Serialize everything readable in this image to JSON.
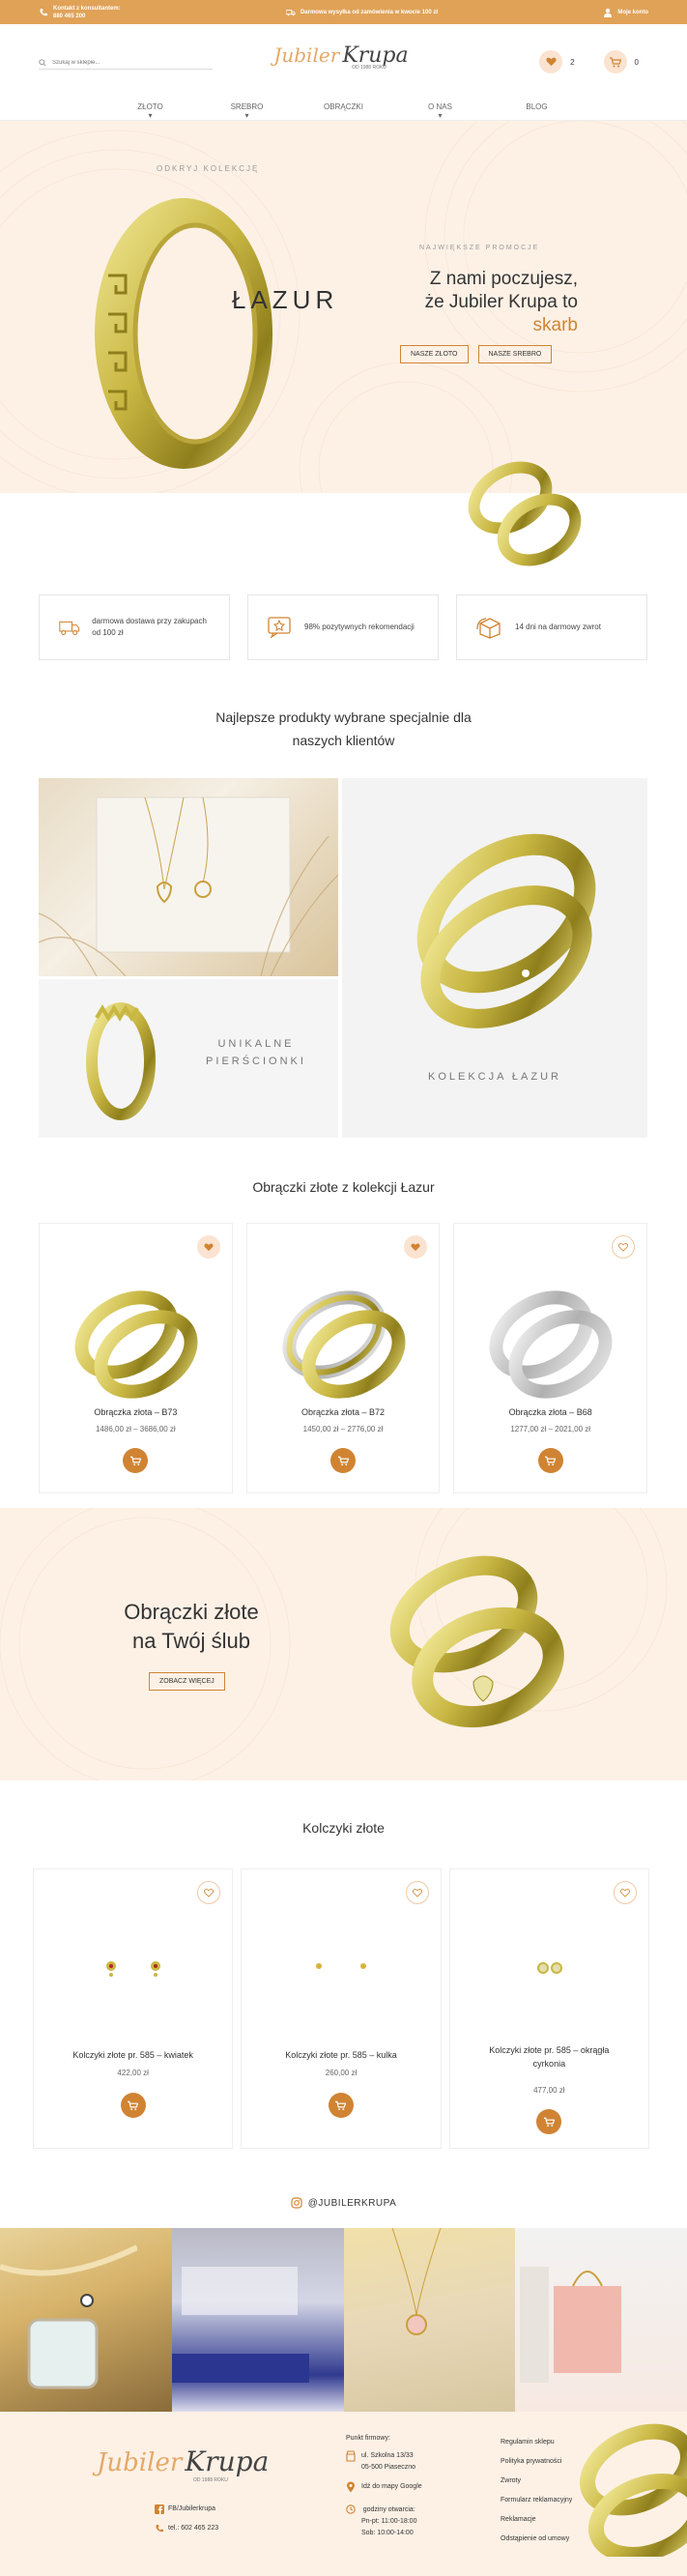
{
  "topbar": {
    "contact_label": "Kontakt z konsultantem:",
    "contact_phone": "880 465 200",
    "shipping_text": "Darmowa wysyłka od zamówienia w kwocie 100 zł",
    "account_label": "Moje konto"
  },
  "header": {
    "search_placeholder": "Szukaj w sklepie...",
    "logo_part1": "Jubiler",
    "logo_part2": "Krupa",
    "logo_since": "OD 1988 ROKU",
    "fav_count": "2",
    "cart_count": "0"
  },
  "nav": {
    "items": [
      {
        "label": "ZŁOTO"
      },
      {
        "label": "SREBRO"
      },
      {
        "label": "OBRĄCZKI"
      },
      {
        "label": "O NAS"
      },
      {
        "label": "BLOG"
      }
    ]
  },
  "hero": {
    "collection_label": "ODKRYJ KOLEKCJĘ",
    "collection_name": "ŁAZUR",
    "promo_label": "NAJWIĘKSZE PROMOCJE",
    "headline_line1": "Z nami poczujesz,",
    "headline_line2": "że Jubiler Krupa to",
    "headline_accent": "skarb",
    "btn_gold": "NASZE ZŁOTO",
    "btn_silver": "NASZE SREBRO"
  },
  "features": [
    {
      "icon": "truck-icon",
      "text": "darmowa dostawa przy zakupach od 100 zł"
    },
    {
      "icon": "rating-icon",
      "text": "98% pozytywnych rekomendacji"
    },
    {
      "icon": "box-return-icon",
      "text": "14 dni na darmowy zwrot"
    }
  ],
  "tagline": {
    "line1": "Najlepsze produkty wybrane specjalnie dla",
    "line2": "naszych klientów"
  },
  "banners": {
    "rings_label_1": "UNIKALNE",
    "rings_label_2": "PIERŚCIONKI",
    "collection_label": "KOLEKCJA ŁAZUR"
  },
  "section_rings": {
    "title": "Obrączki złote z kolekcji Łazur",
    "products": [
      {
        "name": "Obrączka złota – B73",
        "price": "1486,00 zł – 3686,00 zł",
        "fav": true
      },
      {
        "name": "Obrączka złota – B72",
        "price": "1450,00 zł – 2776,00 zł",
        "fav": true
      },
      {
        "name": "Obrączka złota – B68",
        "price": "1277,00 zł – 2021,00 zł",
        "fav": false
      }
    ]
  },
  "wedding_banner": {
    "line1": "Obrączki złote",
    "line2": "na Twój ślub",
    "button": "ZOBACZ WIĘCEJ"
  },
  "section_earrings": {
    "title": "Kolczyki złote",
    "products": [
      {
        "name": "Kolczyki złote pr. 585 – kwiatek",
        "price": "422,00 zł"
      },
      {
        "name": "Kolczyki złote pr. 585 – kulka",
        "price": "260,00 zł"
      },
      {
        "name_line1": "Kolczyki złote pr. 585 – okrągła",
        "name_line2": "cyrkonia",
        "price": "477,00 zł"
      }
    ]
  },
  "instagram": {
    "handle": "@JUBILERKRUPA"
  },
  "footer": {
    "logo_part1": "Jubiler",
    "logo_part2": "Krupa",
    "logo_since": "OD 1988 ROKU",
    "facebook": "FB/Jubilerkrupa",
    "phone": "tel.: 602 465 223",
    "shop_label": "Punkt firmowy:",
    "address_line1": "ul. Szkolna 13/33",
    "address_line2": "05-500 Piaseczno",
    "map_link": "Idź do mapy Google",
    "hours_label": "godziny otwarcia:",
    "hours_weekday": "Pn-pt: 11:00-18:00",
    "hours_sat": "Sob: 10:00-14:00",
    "links": [
      "Regulamin sklepu",
      "Polityka prywatności",
      "Zwroty",
      "Formularz reklamacyjny",
      "Reklamacje",
      "Odstąpienie od umowy"
    ]
  },
  "colors": {
    "accent": "#d08433",
    "topbar": "#e0a257",
    "cream": "#fdf1e6",
    "gold": "#c8b84a"
  }
}
